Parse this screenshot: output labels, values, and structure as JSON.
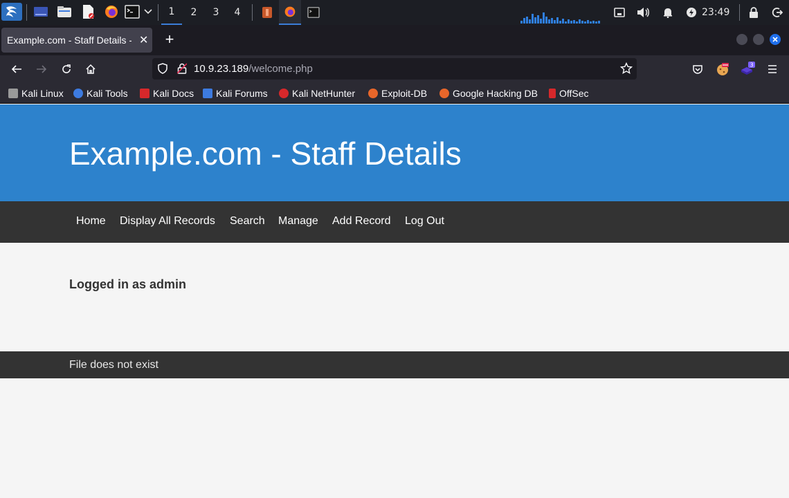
{
  "panel": {
    "workspaces": [
      "1",
      "2",
      "3",
      "4"
    ],
    "active_workspace": "1",
    "clock": "23:49"
  },
  "browser": {
    "tab_title": "Example.com - Staff Details - Mozilla Firefox",
    "url_host": "10.9.23.189",
    "url_path": "/welcome.php",
    "accent": "#1f6feb",
    "extension_badge": "3"
  },
  "bookmarks": [
    {
      "label": "Kali Linux",
      "icon": "kali-dragon-icon",
      "color": "#cfcfcf"
    },
    {
      "label": "Kali Tools",
      "icon": "kali-tools-icon",
      "color": "#3d7be0"
    },
    {
      "label": "Kali Docs",
      "icon": "kali-docs-icon",
      "color": "#d6282b"
    },
    {
      "label": "Kali Forums",
      "icon": "kali-forums-icon",
      "color": "#3d7be0"
    },
    {
      "label": "Kali NetHunter",
      "icon": "nethunter-icon",
      "color": "#d6282b"
    },
    {
      "label": "Exploit-DB",
      "icon": "exploit-db-icon",
      "color": "#e8662a"
    },
    {
      "label": "Google Hacking DB",
      "icon": "ghdb-icon",
      "color": "#e8662a"
    },
    {
      "label": "OffSec",
      "icon": "offsec-icon",
      "color": "#d6282b"
    }
  ],
  "site": {
    "title": "Example.com - Staff Details",
    "header_color": "#2d82cc",
    "nav": [
      "Home",
      "Display All Records",
      "Search",
      "Manage",
      "Add Record",
      "Log Out"
    ],
    "heading": "Logged in as admin",
    "footer": "File does not exist"
  }
}
